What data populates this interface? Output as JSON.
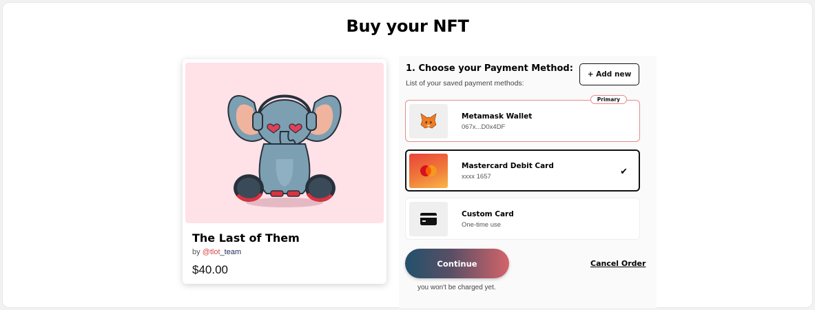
{
  "page": {
    "title": "Buy your NFT"
  },
  "nft": {
    "title": "The Last of Them",
    "by_prefix": "by ",
    "handle_at": "@tlot",
    "handle_rest": "_team",
    "price": "$40.00",
    "image_icon": "elephant-with-headphones-illustration",
    "background_color": "#ffe1e8"
  },
  "payment": {
    "heading": "1. Choose your Payment Method:",
    "subheading": "List of your saved payment methods:",
    "add_button": "+ Add new",
    "methods": [
      {
        "name": "Metamask Wallet",
        "detail": "067x...D0x4DF",
        "badge": "Primary",
        "icon": "metamask-fox-icon",
        "state": "primary"
      },
      {
        "name": "Mastercard Debit Card",
        "detail": "xxxx 1657",
        "icon": "mastercard-icon",
        "state": "selected",
        "check": "✔"
      },
      {
        "name": "Custom Card",
        "detail": "One-time use",
        "icon": "credit-card-icon",
        "state": "default"
      }
    ],
    "continue_button": "Continue",
    "cancel_link": "Cancel Order",
    "note": "you won't be charged yet."
  },
  "colors": {
    "primary_border": "#e88a8a",
    "continue_gradient": [
      "#22506a",
      "#d4646a"
    ],
    "handle_accent": "#d64545"
  }
}
